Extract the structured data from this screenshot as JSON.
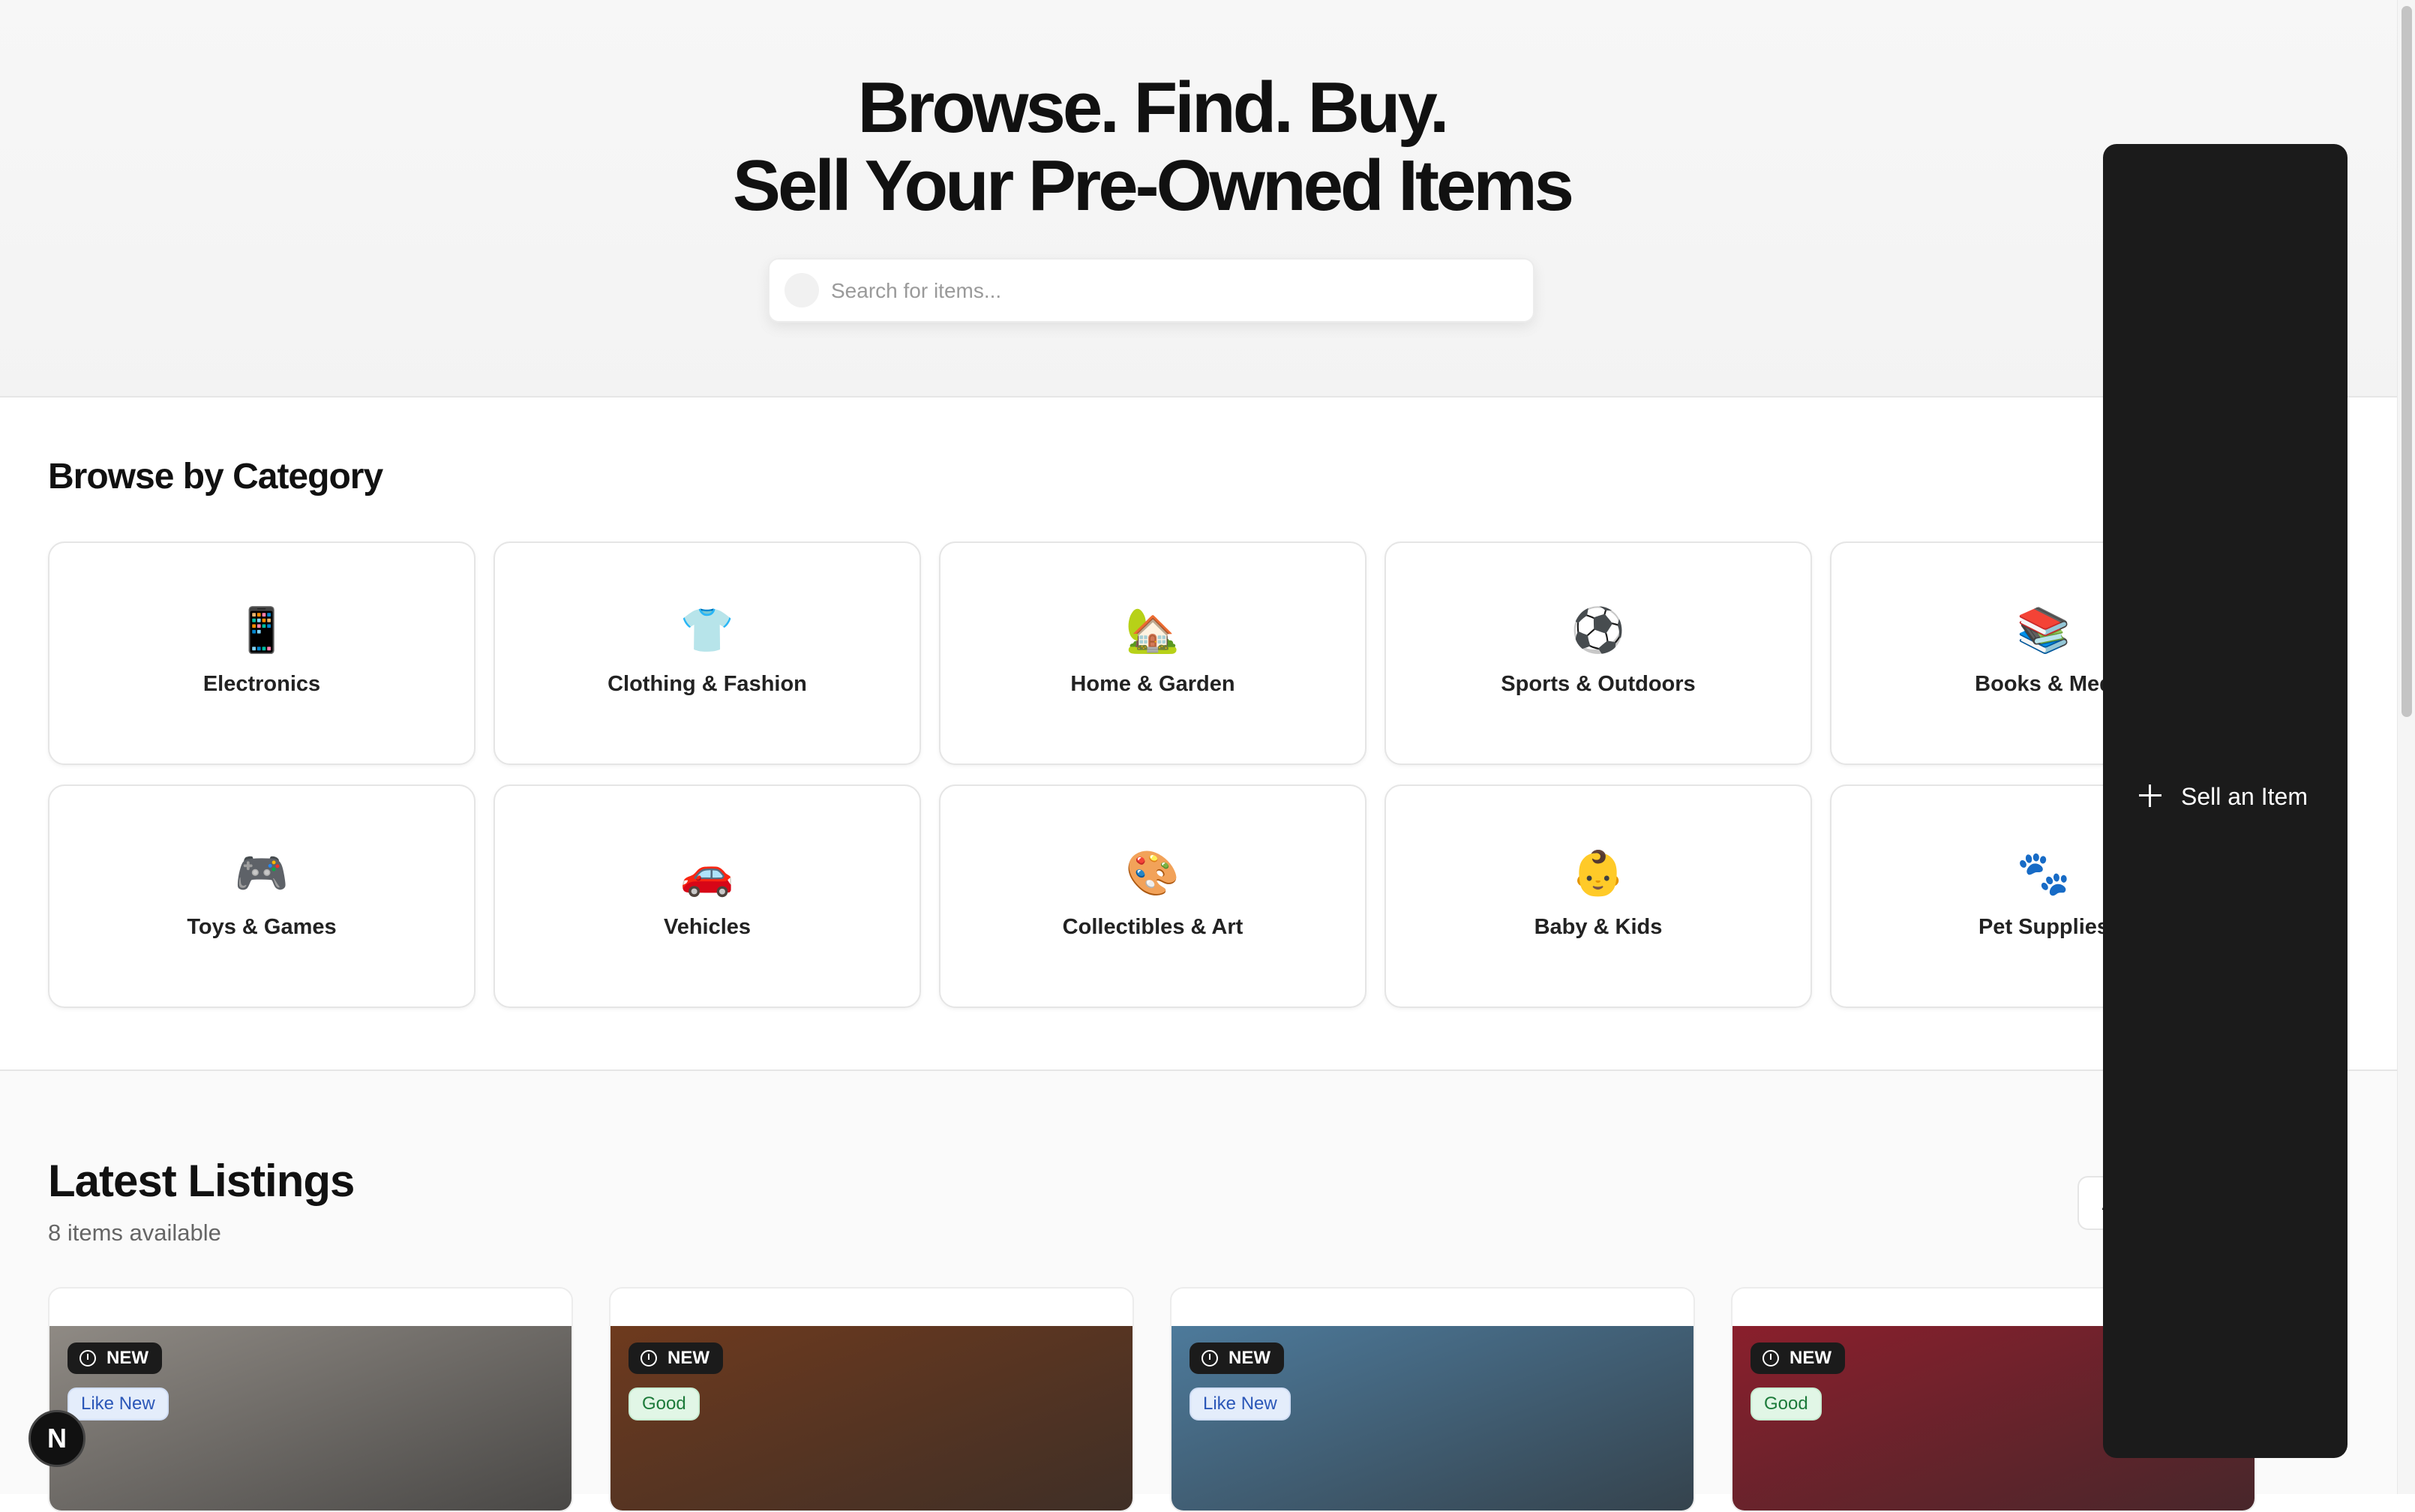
{
  "hero": {
    "title_line1": "Browse. Find. Buy.",
    "title_line2": "Sell Your Pre-Owned Items",
    "search_placeholder": "Search for items..."
  },
  "categories": {
    "title": "Browse by Category",
    "items": [
      {
        "label": "Electronics",
        "emoji": "📱"
      },
      {
        "label": "Clothing & Fashion",
        "emoji": "👕"
      },
      {
        "label": "Home & Garden",
        "emoji": "🏡"
      },
      {
        "label": "Sports & Outdoors",
        "emoji": "⚽"
      },
      {
        "label": "Books & Med",
        "emoji": "📚"
      },
      {
        "label": "Toys & Games",
        "emoji": "🎮"
      },
      {
        "label": "Vehicles",
        "emoji": "🚗"
      },
      {
        "label": "Collectibles & Art",
        "emoji": "🎨"
      },
      {
        "label": "Baby & Kids",
        "emoji": "👶"
      },
      {
        "label": "Pet Supplies",
        "emoji": "🐾"
      }
    ]
  },
  "latest": {
    "title": "Latest Listings",
    "count_text": "8 items available",
    "view_all_label": "A",
    "listings": [
      {
        "new_label": "NEW",
        "condition": "Like New",
        "condition_type": "like",
        "image_color": "#8f8a84"
      },
      {
        "new_label": "NEW",
        "condition": "Good",
        "condition_type": "good",
        "image_color": "#6e3a1e"
      },
      {
        "new_label": "NEW",
        "condition": "Like New",
        "condition_type": "like",
        "image_color": "#4d7a9b"
      },
      {
        "new_label": "NEW",
        "condition": "Good",
        "condition_type": "good",
        "image_color": "#8a1f2c"
      }
    ]
  },
  "sell_panel": {
    "button_label": "Sell an Item",
    "icon": "plus-icon"
  },
  "corner_badge": {
    "letter": "N"
  }
}
